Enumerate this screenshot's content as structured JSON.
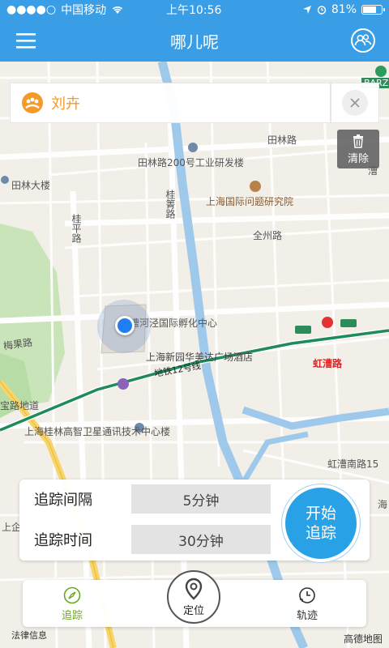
{
  "status_bar": {
    "signal": "●●●●○",
    "carrier": "中国移动",
    "time": "上午10:56",
    "battery": "81%",
    "battery_level": 0.81
  },
  "nav": {
    "title": "哪儿呢",
    "menu_icon": "menu-icon",
    "users_icon": "users-icon"
  },
  "contact": {
    "name": "刘卉"
  },
  "clear_label": "清除",
  "map_labels": {
    "tianlin_road": "田林路",
    "tianlin_200": "田林路200号工业研发楼",
    "tianlin_tower": "田林大楼",
    "guipu_road": "桂箐路",
    "guiping_road": "桂平路",
    "intl_institute": "上海国际问题研究院",
    "quanzhou_road": "全州路",
    "incubator": "漕河泾国际孵化中心",
    "hotel": "上海新园华美达广场酒店",
    "metro12": "地铁12号线",
    "hongcao_road_station": "虹漕路",
    "meiguo_road": "梅果路",
    "baolu_station": "宝路地道",
    "guilin_satellite": "上海桂林高智卫星通讯技术中心楼",
    "hongcao_south": "虹漕南路15",
    "hai": "海",
    "shangqi": "上企",
    "barz": "BARZ",
    "tianlin_right": "漕"
  },
  "tracking": {
    "interval_label": "追踪间隔",
    "interval_value": "5分钟",
    "duration_label": "追踪时间",
    "duration_value": "30分钟",
    "start_label_line1": "开始",
    "start_label_line2": "追踪"
  },
  "tabs": {
    "track": "追踪",
    "locate": "定位",
    "trail": "轨迹"
  },
  "footer": {
    "legal": "法律信息",
    "provider": "高德地图"
  }
}
